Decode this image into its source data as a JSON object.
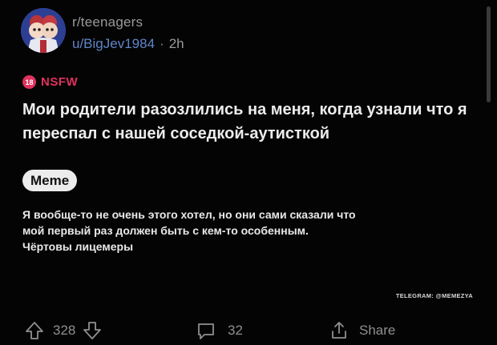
{
  "post": {
    "subreddit": "r/teenagers",
    "author": "u/BigJev1984",
    "separator": "·",
    "age": "2h",
    "nsfw_badge": "18",
    "nsfw_label": "NSFW",
    "title": "Мои родители разозлились на меня, когда узнали что я переспал с нашей соседкой-аутисткой",
    "flair": "Meme",
    "body_lines": [
      "Я вообще-то не очень этого хотел, но они сами сказали что",
      "мой первый раз должен быть с кем-то особенным.",
      "Чёртовы лицемеры"
    ]
  },
  "watermark": "TELEGRAM: @MEMEZYA",
  "actions": {
    "upvote_icon": "upvote-arrow-icon",
    "score": "328",
    "downvote_icon": "downvote-arrow-icon",
    "comment_icon": "comment-bubble-icon",
    "comments": "32",
    "share_icon": "share-icon",
    "share_label": "Share"
  },
  "colors": {
    "background": "#040404",
    "author_link": "#5f86c9",
    "nsfw": "#e0325e",
    "muted": "#8f8f8f"
  }
}
